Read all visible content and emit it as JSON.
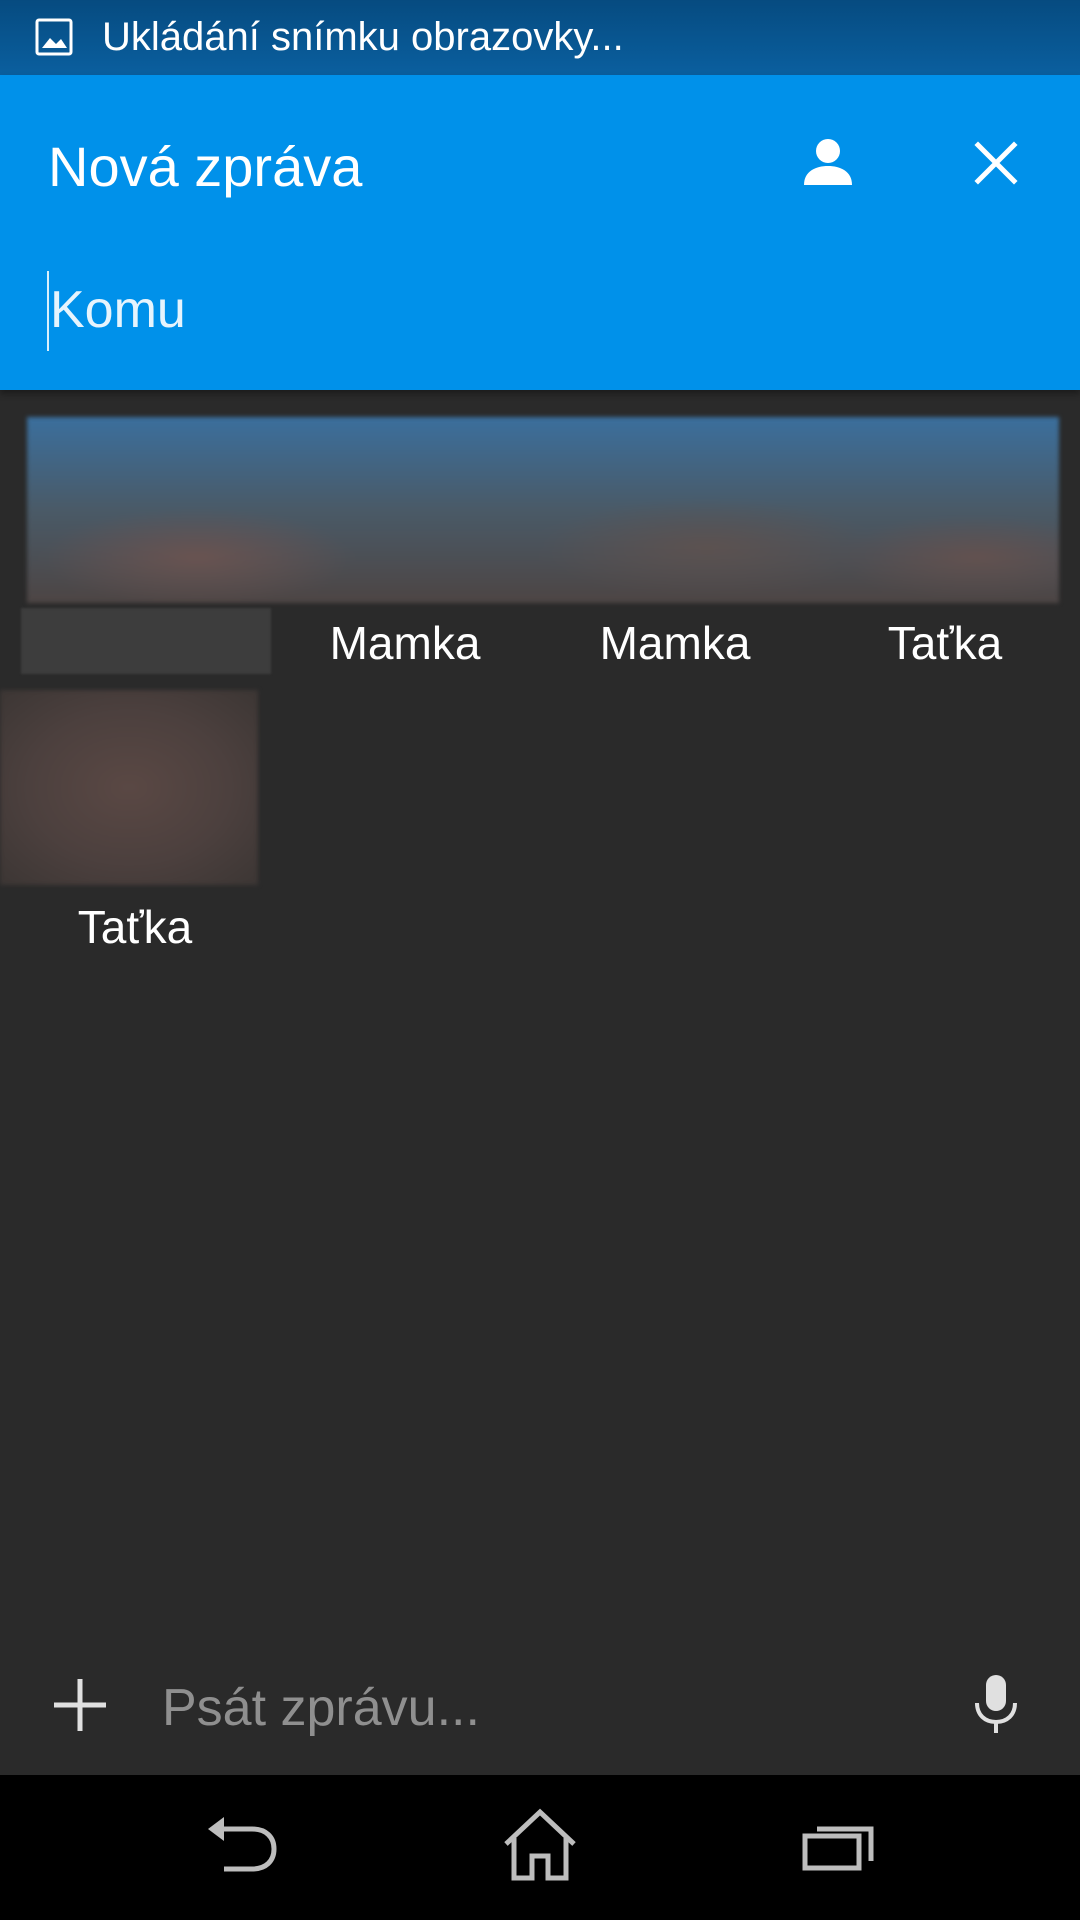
{
  "status_bar": {
    "icon": "image-icon",
    "text": "Ukládání snímku obrazovky..."
  },
  "header": {
    "title": "Nová zpráva",
    "contacts_icon": "person-icon",
    "close_icon": "close-icon",
    "to_placeholder": "Komu",
    "background_color": "#0091ea"
  },
  "recipients": {
    "items": [
      {
        "name": ""
      },
      {
        "name": "Mamka"
      },
      {
        "name": "Mamka"
      },
      {
        "name": "Taťka"
      },
      {
        "name": "Taťka"
      }
    ]
  },
  "compose": {
    "attach_icon": "plus-icon",
    "placeholder": "Psát zprávu...",
    "mic_icon": "microphone-icon"
  },
  "navigation": {
    "back_icon": "back-icon",
    "home_icon": "home-icon",
    "recents_icon": "recent-apps-icon"
  }
}
